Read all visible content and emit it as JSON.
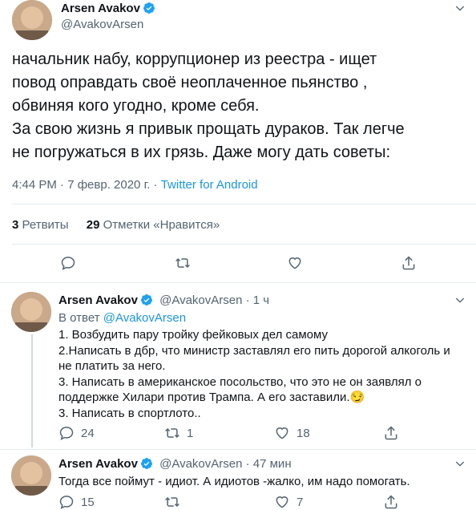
{
  "main_tweet": {
    "author_name": "Arsen Avakov",
    "handle": "@AvakovArsen",
    "text_lines": [
      "начальник набу, коррупционер из реестра - ищет",
      "повод оправдать своё неоплаченное пьянство ,",
      "обвиняя кого угодно, кроме себя.",
      "За свою жизнь я привык прощать дураков. Так легче",
      "не погружаться в их грязь. Даже могу дать советы:"
    ],
    "timestamp": "4:44 PM · 7 февр. 2020 г. · ",
    "source": "Twitter for Android",
    "retweets_count": "3",
    "retweets_label": "Ретвиты",
    "likes_count": "29",
    "likes_label": "Отметки «Нравится»"
  },
  "reply1": {
    "author_name": "Arsen Avakov",
    "meta": "@AvakovArsen · 1 ч",
    "reply_to_prefix": "В ответ ",
    "reply_to_handle": "@AvakovArsen",
    "text_lines": [
      "1. Возбудить пару тройку фейковых дел  самому",
      "2.Написать в дбр, что министр заставлял его пить дорогой алкоголь и",
      "не платить за него.",
      "3. Написать в американское посольство, что это не он заявлял о",
      "поддержке Хилари против Трампа.  А его заставили.😏",
      "3. Написать в спортлото.."
    ],
    "replies": "24",
    "retweets": "1",
    "likes": "18"
  },
  "reply2": {
    "author_name": "Arsen Avakov",
    "meta": "@AvakovArsen · 47 мин",
    "text": "Тогда все поймут - идиот. А идиотов -жалко, им надо помогать.",
    "replies": "15",
    "retweets": "",
    "likes": "7"
  },
  "colors": {
    "accent": "#1b95e0",
    "muted": "#536471",
    "divider": "#e6ecf0"
  }
}
